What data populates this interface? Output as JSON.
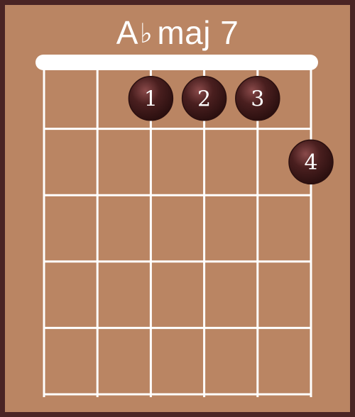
{
  "chord": {
    "name": "A",
    "flat_symbol": "♭",
    "quality": "maj 7"
  },
  "diagram": {
    "strings": 6,
    "frets_shown": 5,
    "nut_visible": true,
    "fingers": [
      {
        "label": "1",
        "string": 3,
        "fret": 1
      },
      {
        "label": "2",
        "string": 4,
        "fret": 1
      },
      {
        "label": "3",
        "string": 5,
        "fret": 1
      },
      {
        "label": "4",
        "string": 6,
        "fret": 2
      }
    ]
  },
  "colors": {
    "background": "#ba8563",
    "border": "#4a2424",
    "lines": "#ffffff",
    "finger_dot": "#4a1f1f",
    "finger_text": "#ffffff"
  }
}
